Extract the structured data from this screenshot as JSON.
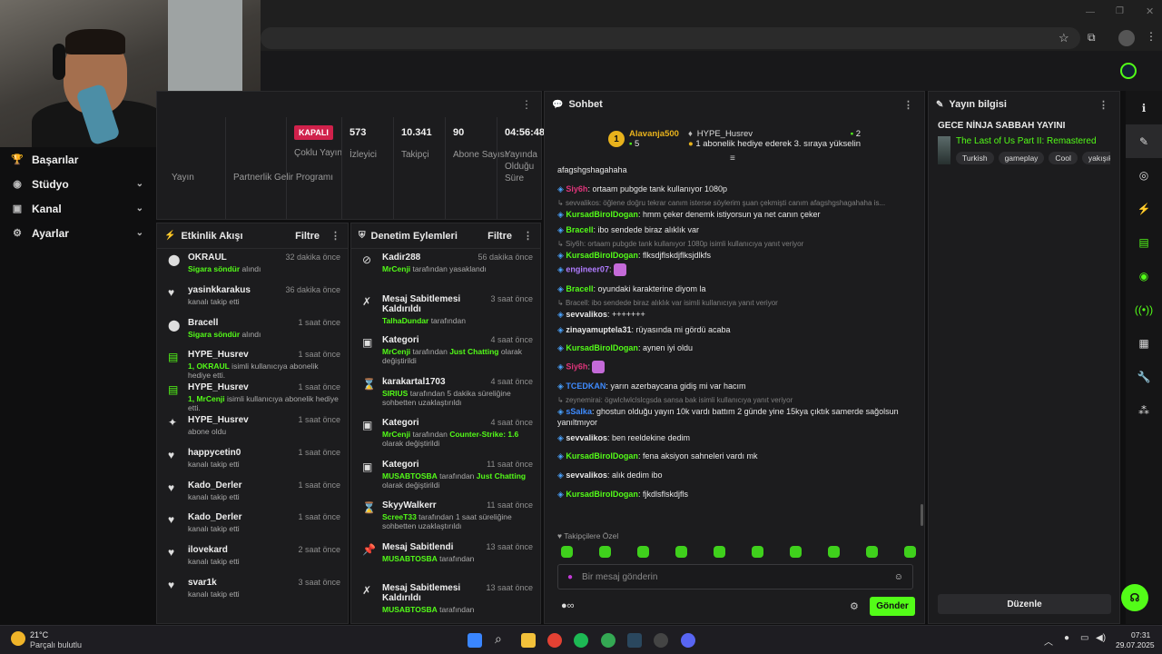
{
  "nav": {
    "items": [
      {
        "label": "Başarılar",
        "icon": "trophy-icon",
        "chevron": false
      },
      {
        "label": "Stüdyo",
        "icon": "studio-icon",
        "chevron": true
      },
      {
        "label": "Kanal",
        "icon": "channel-icon",
        "chevron": true
      },
      {
        "label": "Ayarlar",
        "icon": "gear-icon",
        "chevron": true
      }
    ]
  },
  "stats": {
    "items": [
      {
        "value": "",
        "label": "Yayın"
      },
      {
        "value": "",
        "label": "Partnerlik Gelir Programı"
      },
      {
        "value": "KAPALI",
        "label": "Çoklu Yayın",
        "badge": true
      },
      {
        "value": "573",
        "label": "İzleyici"
      },
      {
        "value": "10.341",
        "label": "Takipçi"
      },
      {
        "value": "90",
        "label": "Abone Sayısı"
      },
      {
        "value": "04:56:48",
        "label": "Yayında Olduğu Süre"
      }
    ]
  },
  "activity": {
    "title": "Etkinlik Akışı",
    "filter": "Filtre",
    "events": [
      {
        "icon": "gift-icon",
        "name": "OKRAUL",
        "time": "32 dakika önce",
        "sub": "Sigara söndür",
        "sub2": " alındı"
      },
      {
        "icon": "heart-icon",
        "name": "yasinkkarakus",
        "time": "36 dakika önce",
        "sub": "",
        "sub2": "kanalı takip etti"
      },
      {
        "icon": "gift-icon",
        "name": "Bracell",
        "time": "1 saat önce",
        "sub": "Sigara söndür",
        "sub2": " alındı"
      },
      {
        "icon": "gift-sub-icon",
        "name": "HYPE_Husrev",
        "time": "1 saat önce",
        "sub": "1, OKRAUL",
        "sub2": " isimli kullanıcıya abonelik hediye etti."
      },
      {
        "icon": "gift-sub-icon",
        "name": "HYPE_Husrev",
        "time": "1 saat önce",
        "sub": "1, MrCenji",
        "sub2": " isimli kullanıcıya abonelik hediye etti."
      },
      {
        "icon": "sparkle-icon",
        "name": "HYPE_Husrev",
        "time": "1 saat önce",
        "sub": "",
        "sub2": "abone oldu"
      },
      {
        "icon": "heart-icon",
        "name": "happycetin0",
        "time": "1 saat önce",
        "sub": "",
        "sub2": "kanalı takip etti"
      },
      {
        "icon": "heart-icon",
        "name": "Kado_Derler",
        "time": "1 saat önce",
        "sub": "",
        "sub2": "kanalı takip etti"
      },
      {
        "icon": "heart-icon",
        "name": "Kado_Derler",
        "time": "1 saat önce",
        "sub": "",
        "sub2": "kanalı takip etti"
      },
      {
        "icon": "heart-icon",
        "name": "ilovekard",
        "time": "2 saat önce",
        "sub": "",
        "sub2": "kanalı takip etti"
      },
      {
        "icon": "heart-icon",
        "name": "svar1k",
        "time": "3 saat önce",
        "sub": "",
        "sub2": "kanalı takip etti"
      }
    ]
  },
  "moderation": {
    "title": "Denetim Eylemleri",
    "filter": "Filtre",
    "events": [
      {
        "icon": "ban-icon",
        "name": "Kadir288",
        "time": "56 dakika önce",
        "g": "MrCenji",
        "rest": " tarafından yasaklandı",
        "g2": "",
        "rest2": ""
      },
      {
        "icon": "unpin-icon",
        "name": "Mesaj Sabitlemesi Kaldırıldı",
        "time": "3 saat önce",
        "g": "TalhaDundar",
        "rest": " tarafından",
        "g2": "",
        "rest2": ""
      },
      {
        "icon": "category-icon",
        "name": "Kategori",
        "time": "4 saat önce",
        "g": "MrCenji",
        "rest": " tarafından ",
        "g2": "Just Chatting",
        "rest2": " olarak değiştirildi"
      },
      {
        "icon": "timeout-icon",
        "name": "karakartal1703",
        "time": "4 saat önce",
        "g": "SIRIUS",
        "rest": " tarafından 5 dakika süreliğine sohbetten uzaklaştırıldı",
        "g2": "",
        "rest2": ""
      },
      {
        "icon": "category-icon",
        "name": "Kategori",
        "time": "4 saat önce",
        "g": "MrCenji",
        "rest": " tarafından ",
        "g2": "Counter-Strike: 1.6",
        "rest2": " olarak değiştirildi"
      },
      {
        "icon": "category-icon",
        "name": "Kategori",
        "time": "11 saat önce",
        "g": "MUSABTOSBA",
        "rest": " tarafından ",
        "g2": "Just Chatting",
        "rest2": " olarak değiştirildi"
      },
      {
        "icon": "timeout-icon",
        "name": "SkyyWalkerr",
        "time": "11 saat önce",
        "g": "ScreeT33",
        "rest": " tarafından 1 saat süreliğine sohbetten uzaklaştırıldı",
        "g2": "",
        "rest2": ""
      },
      {
        "icon": "pin-icon",
        "name": "Mesaj Sabitlendi",
        "time": "13 saat önce",
        "g": "MUSABTOSBA",
        "rest": " tarafından",
        "g2": "",
        "rest2": ""
      },
      {
        "icon": "unpin-icon",
        "name": "Mesaj Sabitlemesi Kaldırıldı",
        "time": "13 saat önce",
        "g": "MUSABTOSBA",
        "rest": " tarafından",
        "g2": "",
        "rest2": ""
      },
      {
        "icon": "category-icon",
        "name": "Kategori",
        "time": "13 saat önce",
        "g": "",
        "rest": "",
        "g2": "",
        "rest2": ""
      }
    ]
  },
  "chat": {
    "title": "Sohbet",
    "pinned": {
      "user": "Alavanja500",
      "level": "1",
      "count": "5",
      "gifter": "HYPE_Husrev",
      "gift_count": "2",
      "gift_text": "1 abonelik hediye ederek 3. sıraya yükselin"
    },
    "messages": [
      {
        "reply": "",
        "user": "",
        "color": "#e8e8e8",
        "text": "afagshgshagahaha"
      },
      {
        "reply": "",
        "user": "Siy6h",
        "color": "#e0357b",
        "text": "ortaam pubgde tank kullanıyor 1080p"
      },
      {
        "reply": "sevvalikos: öğlene doğru tekrar canım isterse söylerim şuan çekmişti canım afagshgshagahaha is...",
        "user": "KursadBirolDogan",
        "color": "#53fc18",
        "text": "hmm çeker denemk istiyorsun ya net canın çeker"
      },
      {
        "reply": "",
        "user": "Bracell",
        "color": "#53fc18",
        "text": "ibo sendede biraz alıklık var"
      },
      {
        "reply": "Siy6h: ortaam pubgde tank kullanıyor 1080p isimli kullanıcıya yanıt veriyor",
        "user": "KursadBirolDogan",
        "color": "#53fc18",
        "text": "flksdjflskdjflksjdlkfs"
      },
      {
        "reply": "",
        "user": "engineer07",
        "color": "#b07cff",
        "text": "[emote]"
      },
      {
        "reply": "",
        "user": "Bracell",
        "color": "#53fc18",
        "text": "oyundaki karakterine diyom la"
      },
      {
        "reply": "Bracell: ibo sendede biraz alıklık var isimli kullanıcıya yanıt veriyor",
        "user": "sevvalikos",
        "color": "#e8e8e8",
        "text": "+++++++"
      },
      {
        "reply": "",
        "user": "zinayamuptela31",
        "color": "#e8e8e8",
        "text": "rüyasında mi gördü acaba"
      },
      {
        "reply": "",
        "user": "KursadBirolDogan",
        "color": "#53fc18",
        "text": "aynen iyi oldu"
      },
      {
        "reply": "",
        "user": "Siy6h",
        "color": "#e0357b",
        "text": "[emote]"
      },
      {
        "reply": "",
        "user": "TCEDKAN",
        "color": "#3e8bff",
        "text": "yarın azerbaycana gidiş mi var hacım"
      },
      {
        "reply": "zeynemirai: ögwlclwlclslcgsda sansa bak isimli kullanıcıya yanıt veriyor",
        "user": "sSalka",
        "color": "#3e8bff",
        "text": "ghostun olduğu yayın 10k vardı battım 2 günde yine 15kya çıktık samerde sağolsun yanıltmıyor"
      },
      {
        "reply": "",
        "user": "sevvalikos",
        "color": "#e8e8e8",
        "text": "ben reeldekine dedim"
      },
      {
        "reply": "",
        "user": "KursadBirolDogan",
        "color": "#53fc18",
        "text": "fena aksiyon sahneleri vardı mk"
      },
      {
        "reply": "",
        "user": "sevvalikos",
        "color": "#e8e8e8",
        "text": "alık dedim ibo"
      },
      {
        "reply": "",
        "user": "KursadBirolDogan",
        "color": "#53fc18",
        "text": "fjkdlsflskdjfls"
      }
    ],
    "followers_only": "Takipçilere Özel",
    "input_placeholder": "Bir mesaj gönderin",
    "send": "Gönder"
  },
  "info": {
    "title": "Yayın bilgisi",
    "stream_title": "GECE NİNJA SABBAH YAYINI",
    "game": "The Last of Us Part II: Remastered",
    "tags": [
      "Turkish",
      "gameplay",
      "Cool",
      "yakışık"
    ],
    "edit": "Düzenle"
  },
  "taskbar": {
    "weather": "21°C",
    "weather_desc": "Parçalı bulutlu",
    "time": "07:31",
    "date": "29.07.2025"
  },
  "colors": {
    "accent": "#53fc18",
    "badge": "#d0214b"
  }
}
